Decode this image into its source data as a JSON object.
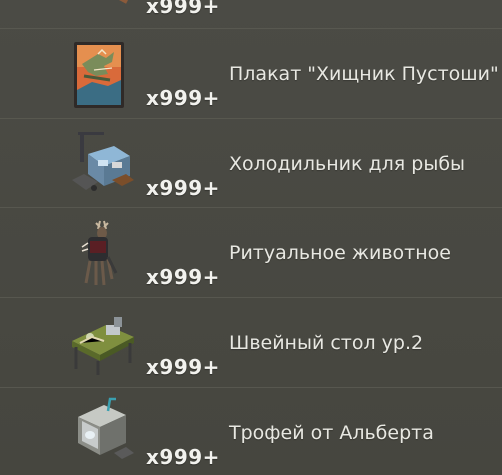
{
  "inventory": {
    "partial_top": {
      "count": "x999+"
    },
    "items": [
      {
        "name": "Плакат \"Хищник Пустоши\"",
        "count": "x999+",
        "icon": "poster-icon"
      },
      {
        "name": "Холодильник для рыбы",
        "count": "x999+",
        "icon": "fish-fridge-icon"
      },
      {
        "name": "Ритуальное животное",
        "count": "x999+",
        "icon": "ritual-deer-icon"
      },
      {
        "name": "Швейный стол ур.2",
        "count": "x999+",
        "icon": "sewing-table-icon"
      },
      {
        "name": "Трофей от Альберта",
        "count": "x999+",
        "icon": "trophy-case-icon"
      }
    ]
  },
  "colors": {
    "background": "#4a4a44",
    "divider": "#5b5b53",
    "text": "#e8e8e2",
    "count_text": "#f2f2ee"
  }
}
